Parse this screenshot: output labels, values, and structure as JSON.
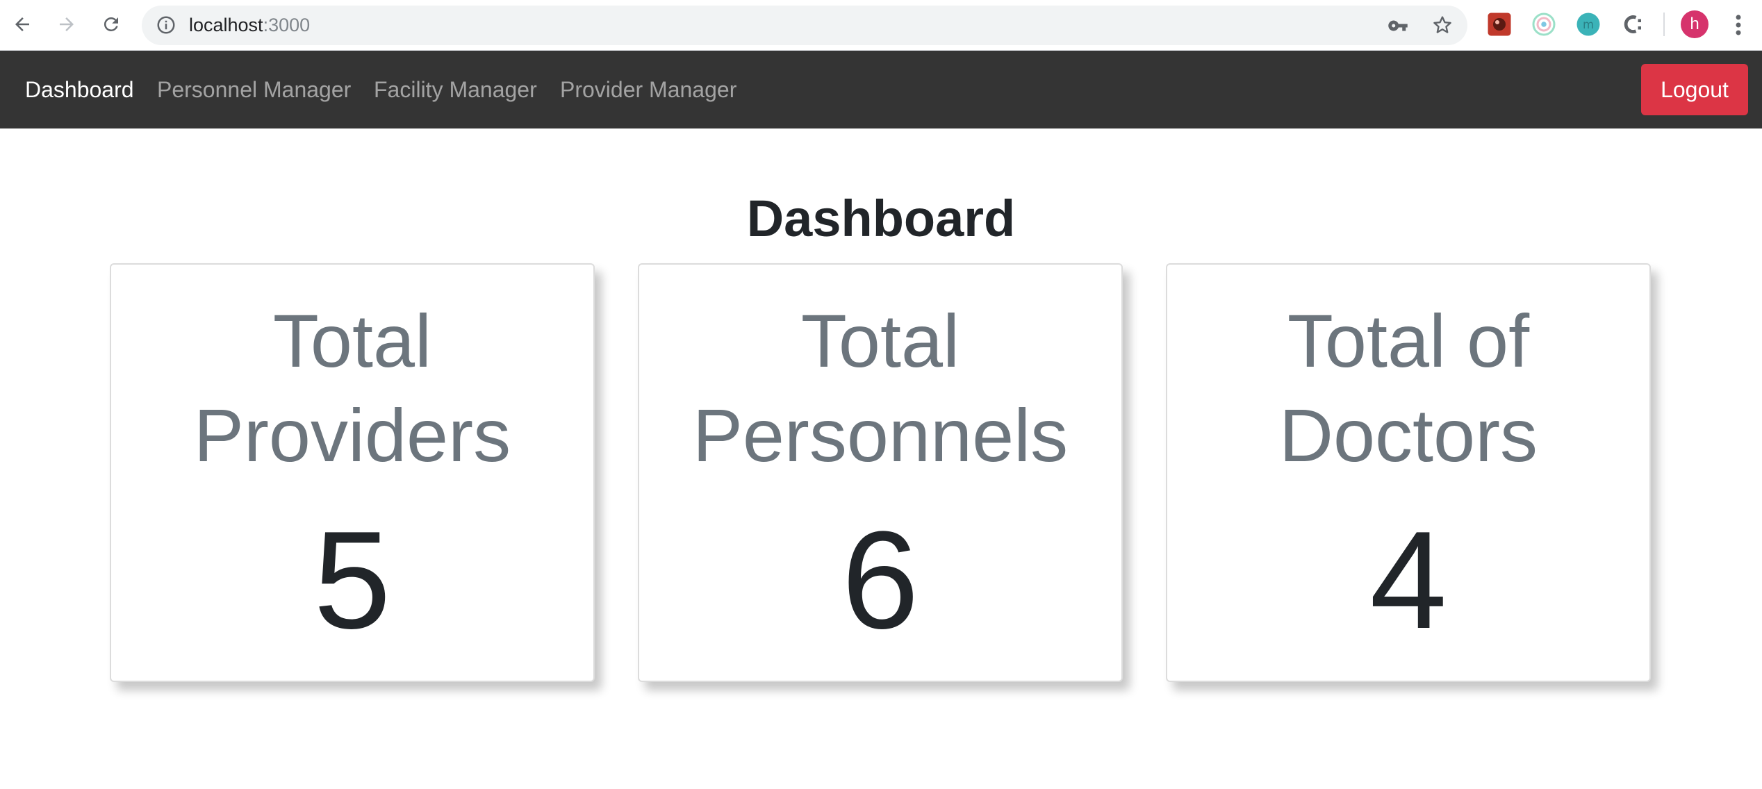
{
  "browser": {
    "url_host": "localhost",
    "url_port": ":3000",
    "profile_initial": "h"
  },
  "navbar": {
    "links": [
      {
        "label": "Dashboard",
        "active": true
      },
      {
        "label": "Personnel Manager",
        "active": false
      },
      {
        "label": "Facility Manager",
        "active": false
      },
      {
        "label": "Provider Manager",
        "active": false
      }
    ],
    "logout_label": "Logout",
    "colors": {
      "background": "#343434",
      "logout": "#dc3545"
    }
  },
  "main": {
    "title": "Dashboard",
    "cards": [
      {
        "title_line1": "Total",
        "title_line2": "Providers",
        "value": "5"
      },
      {
        "title_line1": "Total",
        "title_line2": "Personnels",
        "value": "6"
      },
      {
        "title_line1": "Total of",
        "title_line2": "Doctors",
        "value": "4"
      }
    ]
  }
}
